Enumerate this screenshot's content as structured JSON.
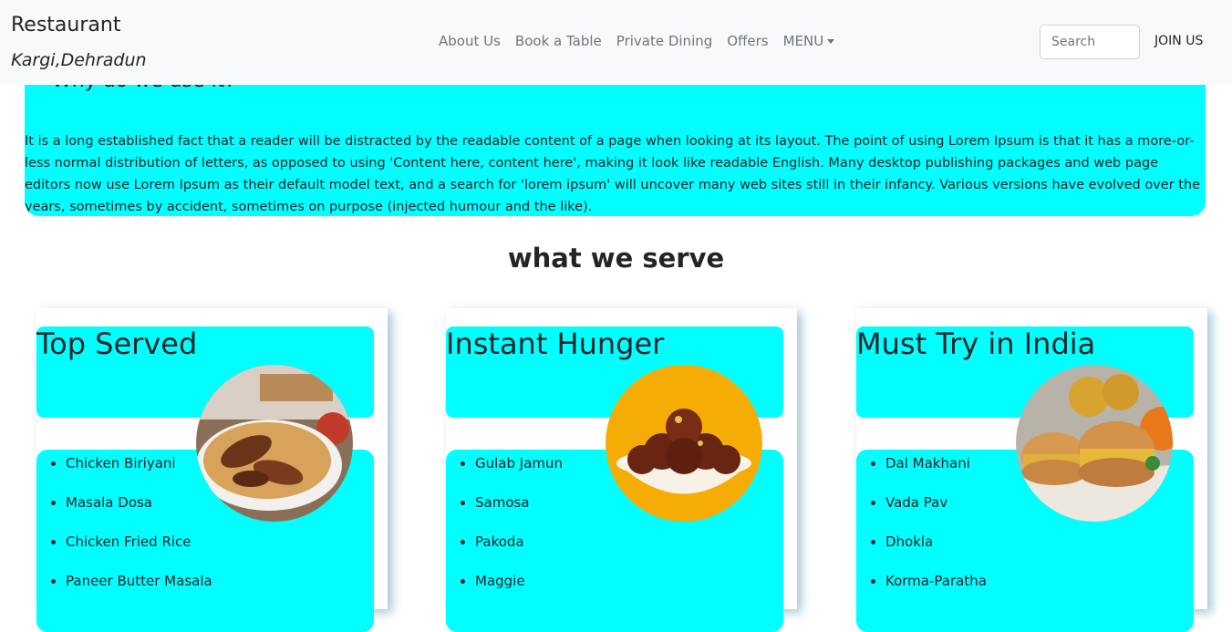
{
  "brand": {
    "title": "Restaurant",
    "subtitle": "Kargi,Dehradun"
  },
  "nav": {
    "links": [
      "About Us",
      "Book a Table",
      "Private Dining",
      "Offers"
    ],
    "menu_label": "MENU",
    "search_placeholder": "Search",
    "join_label": "JOIN US"
  },
  "why": {
    "heading": "Why do we use it?",
    "text": "It is a long established fact that a reader will be distracted by the readable content of a page when looking at its layout. The point of using Lorem Ipsum is that it has a more-or-less normal distribution of letters, as opposed to using 'Content here, content here', making it look like readable English. Many desktop publishing packages and web page editors now use Lorem Ipsum as their default model text, and a search for 'lorem ipsum' will uncover many web sites still in their infancy. Various versions have evolved over the years, sometimes by accident, sometimes on purpose (injected humour and the like)."
  },
  "serve": {
    "title": "what we serve",
    "cards": [
      {
        "title": "Top Served",
        "image": "biryani-photo",
        "items": [
          "Chicken Biriyani",
          "Masala Dosa",
          "Chicken Fried Rice",
          "Paneer Butter Masala"
        ]
      },
      {
        "title": "Instant Hunger",
        "image": "gulab-jamun-photo",
        "items": [
          "Gulab Jamun",
          "Samosa",
          "Pakoda",
          "Maggie"
        ]
      },
      {
        "title": "Must Try in India",
        "image": "vada-pav-photo",
        "items": [
          "Dal Makhani",
          "Vada Pav",
          "Dhokla",
          "Korma-Paratha"
        ]
      }
    ]
  },
  "colors": {
    "accent": "#00ffff",
    "navbar_bg": "#f8f9fa",
    "nav_link": "#6c757d"
  }
}
